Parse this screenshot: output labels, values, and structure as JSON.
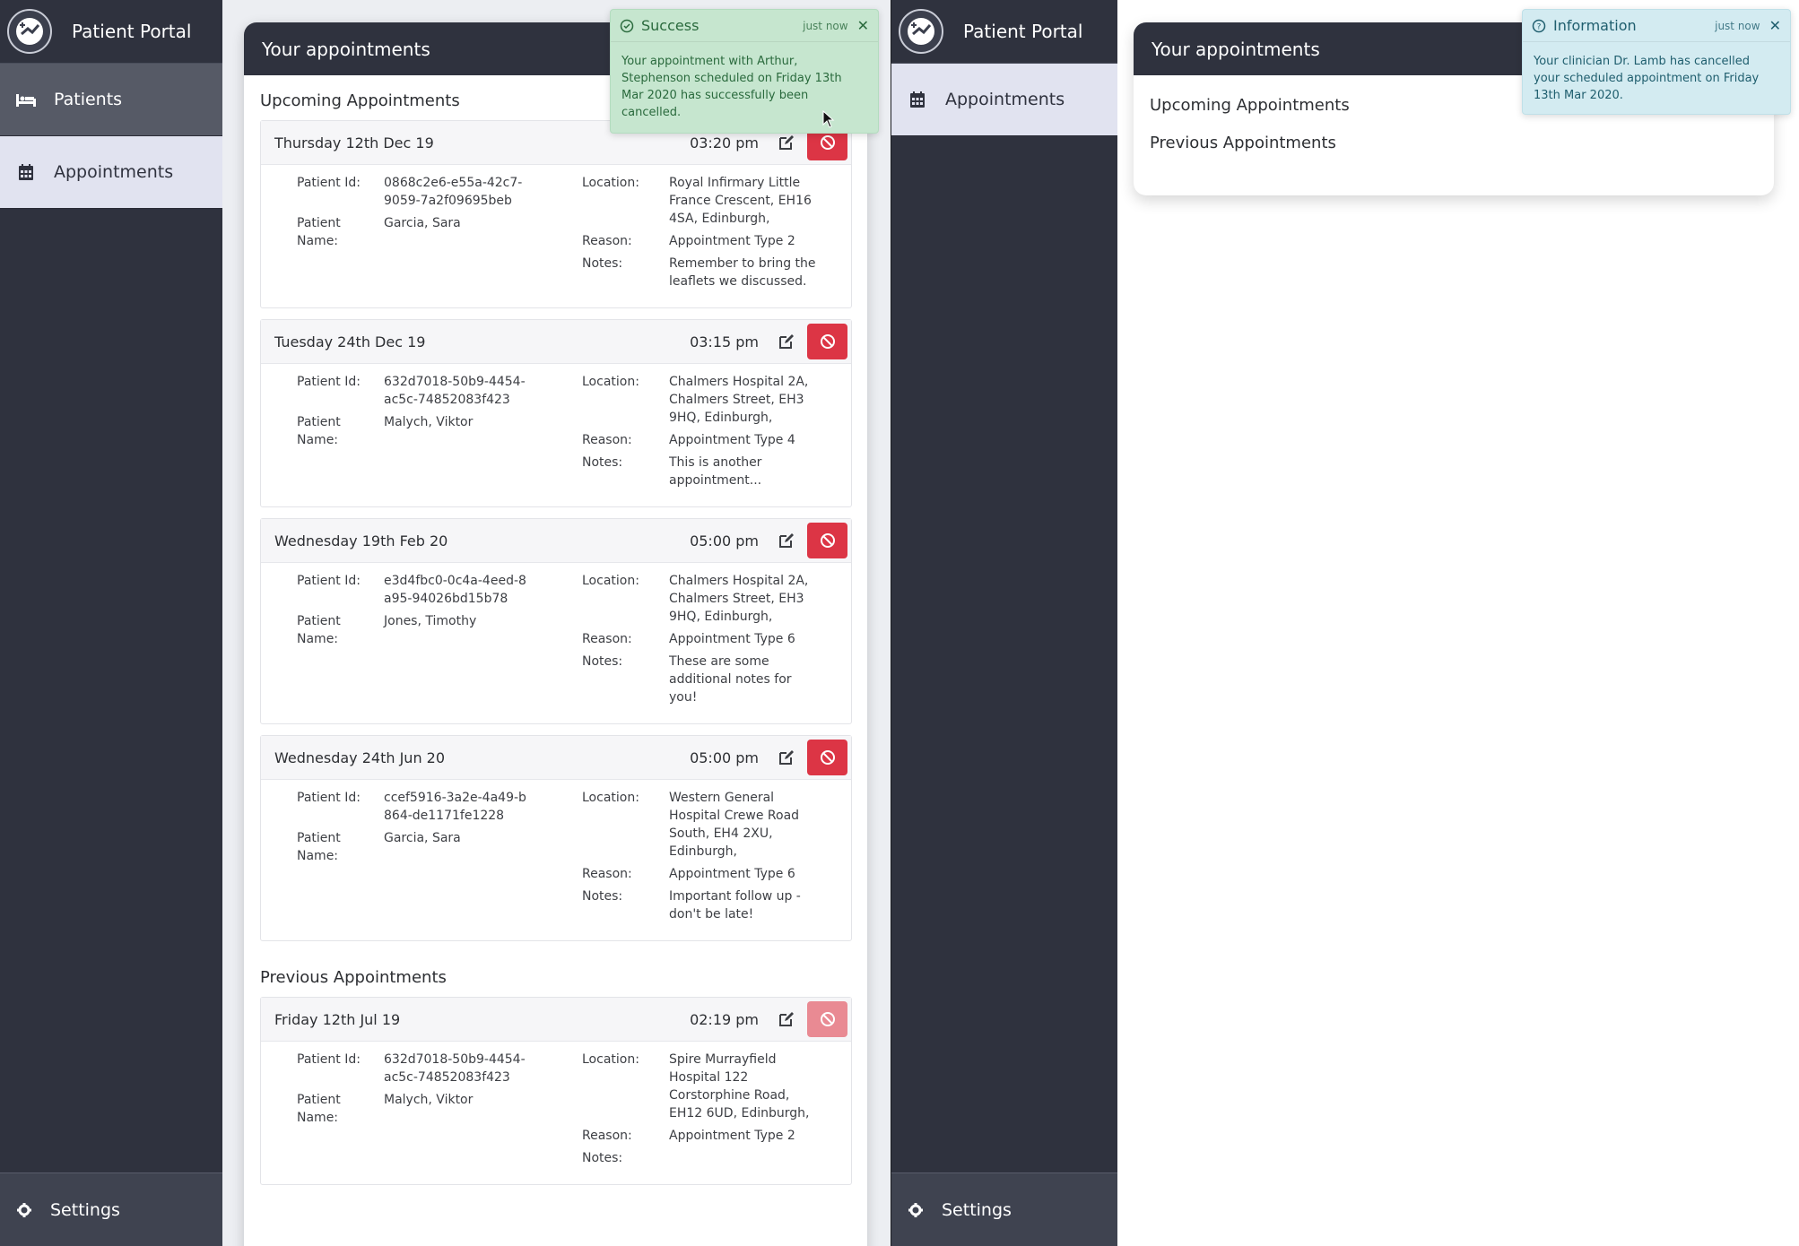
{
  "app": {
    "title": "Patient Portal"
  },
  "left": {
    "nav": [
      {
        "label": "Patients",
        "icon": "bed-icon"
      },
      {
        "label": "Appointments",
        "icon": "calendar-icon"
      }
    ],
    "settings_label": "Settings",
    "panel_title": "Your appointments",
    "upcoming_title": "Upcoming Appointments",
    "previous_title": "Previous Appointments",
    "labels": {
      "patient_id": "Patient Id:",
      "patient_name": "Patient Name:",
      "location": "Location:",
      "reason": "Reason:",
      "notes": "Notes:"
    },
    "upcoming": [
      {
        "date": "Thursday 12th Dec 19",
        "time": "03:20 pm",
        "patient_id": "0868c2e6-e55a-42c7-9059-7a2f09695beb",
        "patient_name": "Garcia, Sara",
        "location": "Royal Infirmary Little France Crescent, EH16 4SA, Edinburgh,",
        "reason": "Appointment Type 2",
        "notes": "Remember to bring the leaflets we discussed."
      },
      {
        "date": "Tuesday 24th Dec 19",
        "time": "03:15 pm",
        "patient_id": "632d7018-50b9-4454-ac5c-74852083f423",
        "patient_name": "Malych, Viktor",
        "location": "Chalmers Hospital 2A, Chalmers Street, EH3 9HQ, Edinburgh,",
        "reason": "Appointment Type 4",
        "notes": "This is another appointment..."
      },
      {
        "date": "Wednesday 19th Feb 20",
        "time": "05:00 pm",
        "patient_id": "e3d4fbc0-0c4a-4eed-8a95-94026bd15b78",
        "patient_name": "Jones, Timothy",
        "location": "Chalmers Hospital 2A, Chalmers Street, EH3 9HQ, Edinburgh,",
        "reason": "Appointment Type 6",
        "notes": "These are some additional notes for you!"
      },
      {
        "date": "Wednesday 24th Jun 20",
        "time": "05:00 pm",
        "patient_id": "ccef5916-3a2e-4a49-b864-de1171fe1228",
        "patient_name": "Garcia, Sara",
        "location": "Western General Hospital Crewe Road South, EH4 2XU, Edinburgh,",
        "reason": "Appointment Type 6",
        "notes": "Important follow up - don't be late!"
      }
    ],
    "previous": [
      {
        "date": "Friday 12th Jul 19",
        "time": "02:19 pm",
        "patient_id": "632d7018-50b9-4454-ac5c-74852083f423",
        "patient_name": "Malych, Viktor",
        "location": "Spire Murrayfield Hospital 122 Corstorphine Road, EH12 6UD, Edinburgh,",
        "reason": "Appointment Type 2",
        "notes": ""
      }
    ],
    "toast": {
      "title": "Success",
      "time": "just now",
      "close": "✕",
      "message": "Your appointment with Arthur, Stephenson scheduled on Friday 13th Mar 2020 has successfully been cancelled."
    }
  },
  "right": {
    "nav": [
      {
        "label": "Appointments",
        "icon": "calendar-icon"
      }
    ],
    "settings_label": "Settings",
    "panel_title": "Your appointments",
    "upcoming_title": "Upcoming Appointments",
    "previous_title": "Previous Appointments",
    "toast": {
      "title": "Information",
      "time": "just now",
      "close": "✕",
      "message": "Your clinician Dr. Lamb has cancelled your scheduled appointment on Friday 13th Mar 2020."
    }
  },
  "colors": {
    "sidebar": "#2f323e",
    "danger": "#dc3545",
    "success_toast": "#c6e6cf",
    "info_toast": "#d3ebf1",
    "active_nav": "#e1e3f0"
  }
}
